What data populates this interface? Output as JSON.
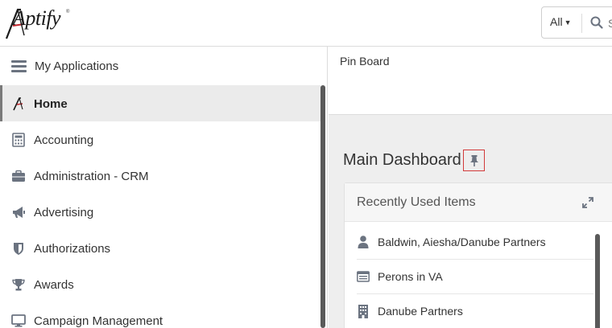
{
  "app": {
    "logo_text": "Aptify",
    "logo_mark": "®"
  },
  "header": {
    "search_scope": "All",
    "search_placeholder": "S"
  },
  "sidebar": {
    "header_label": "My Applications",
    "items": [
      {
        "label": "Home",
        "icon": "aptify-logo-icon",
        "active": true
      },
      {
        "label": "Accounting",
        "icon": "calculator-icon"
      },
      {
        "label": "Administration - CRM",
        "icon": "briefcase-icon"
      },
      {
        "label": "Advertising",
        "icon": "megaphone-icon"
      },
      {
        "label": "Authorizations",
        "icon": "shield-icon"
      },
      {
        "label": "Awards",
        "icon": "trophy-icon"
      },
      {
        "label": "Campaign Management",
        "icon": "monitor-icon"
      }
    ]
  },
  "main": {
    "pinboard_title": "Pin Board",
    "dashboard_title": "Main Dashboard",
    "widget": {
      "title": "Recently Used Items",
      "items": [
        {
          "label": "Baldwin, Aiesha/Danube Partners",
          "icon": "person-icon"
        },
        {
          "label": "Perons in VA",
          "icon": "list-view-icon"
        },
        {
          "label": "Danube Partners",
          "icon": "building-icon"
        }
      ]
    }
  },
  "colors": {
    "icon_gray": "#6b7380",
    "active_bg": "#ebebeb",
    "pin_border": "#d23a3a",
    "main_bg": "#eeeeee"
  }
}
